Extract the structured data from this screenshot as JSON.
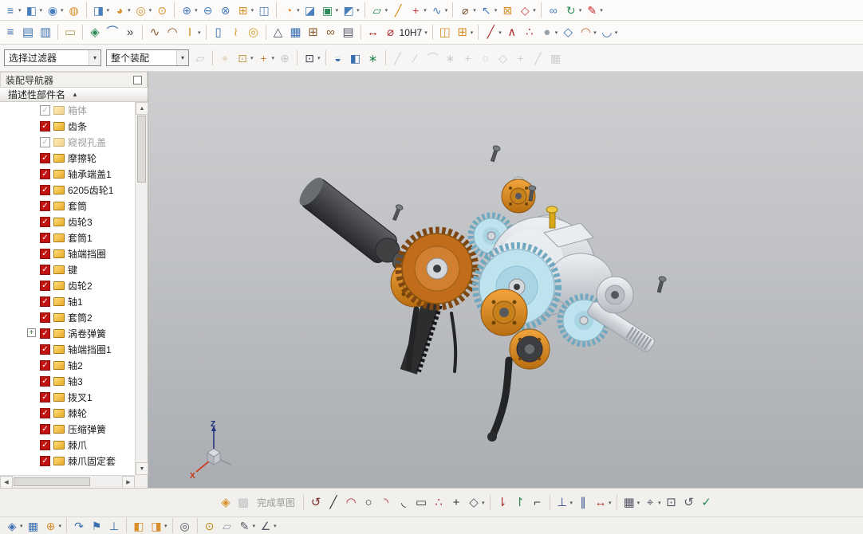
{
  "glyphs": {
    "caret": "▾",
    "check": "✓",
    "plus": "+",
    "sort_asc": "▲",
    "scroll_up": "▲",
    "scroll_down": "▼",
    "scroll_left": "◀",
    "scroll_right": "▶"
  },
  "toolbars": {
    "row1": [
      {
        "name": "sheet-stack-icon",
        "glyph": "≡",
        "color": "#3a6fb0",
        "arrow": true
      },
      {
        "name": "block-feature-icon",
        "glyph": "◧",
        "color": "#4a7fbd",
        "arrow": true
      },
      {
        "name": "cylinder-feature-icon",
        "glyph": "◉",
        "color": "#4a7fbd",
        "arrow": true
      },
      {
        "name": "sphere-feature-icon",
        "glyph": "◍",
        "color": "#d98f2b"
      },
      {
        "sep": true
      },
      {
        "name": "extrude-icon",
        "glyph": "◨",
        "color": "#4a7fbd",
        "arrow": true
      },
      {
        "name": "revolve-icon",
        "glyph": "◕",
        "color": "#d98f2b",
        "arrow": true
      },
      {
        "name": "hole-feature-icon",
        "glyph": "◎",
        "color": "#d98f2b",
        "arrow": true
      },
      {
        "name": "boss-feature-icon",
        "glyph": "⊙",
        "color": "#d98f2b"
      },
      {
        "sep": true
      },
      {
        "name": "boolean-unite-icon",
        "glyph": "⊕",
        "color": "#4a7fbd",
        "arrow": true
      },
      {
        "name": "boolean-subtract-icon",
        "glyph": "⊖",
        "color": "#4a7fbd"
      },
      {
        "name": "boolean-intersect-icon",
        "glyph": "⊗",
        "color": "#4a7fbd"
      },
      {
        "name": "pattern-feature-icon",
        "glyph": "⊞",
        "color": "#d98f2b",
        "arrow": true
      },
      {
        "name": "mirror-feature-icon",
        "glyph": "◫",
        "color": "#4a7fbd"
      },
      {
        "sep": true
      },
      {
        "name": "edge-blend-icon",
        "glyph": "◔",
        "color": "#d98f2b",
        "arrow": true
      },
      {
        "name": "chamfer-icon",
        "glyph": "◪",
        "color": "#4a7fbd"
      },
      {
        "name": "shell-icon",
        "glyph": "▣",
        "color": "#2e8b57",
        "arrow": true
      },
      {
        "name": "trim-body-icon",
        "glyph": "◩",
        "color": "#4a7fbd",
        "arrow": true
      },
      {
        "sep": true
      },
      {
        "name": "datum-plane-icon",
        "glyph": "▱",
        "color": "#2e8b57",
        "arrow": true
      },
      {
        "name": "datum-axis-icon",
        "glyph": "╱",
        "color": "#cc8800"
      },
      {
        "name": "point-feature-icon",
        "glyph": "+",
        "color": "#cc3333",
        "arrow": true
      },
      {
        "name": "swept-icon",
        "glyph": "∿",
        "color": "#4a7fbd",
        "arrow": true
      },
      {
        "sep": true
      },
      {
        "name": "measure-distance-icon",
        "glyph": "⌀",
        "color": "#7a5230",
        "arrow": true
      },
      {
        "name": "move-face-icon",
        "glyph": "↖",
        "color": "#4a7fbd",
        "arrow": true
      },
      {
        "name": "offset-region-icon",
        "glyph": "⊠",
        "color": "#d98f2b"
      },
      {
        "name": "delete-face-icon",
        "glyph": "◇",
        "color": "#cc4444",
        "arrow": true
      },
      {
        "sep": true
      },
      {
        "name": "wave-geometry-icon",
        "glyph": "∞",
        "color": "#4a7fbd"
      },
      {
        "name": "update-model-icon",
        "glyph": "↻",
        "color": "#2e8b57",
        "arrow": true
      },
      {
        "name": "edit-feature-icon",
        "glyph": "✎",
        "color": "#cc2222",
        "arrow": true
      }
    ],
    "row2": [
      {
        "name": "layer-settings-icon",
        "glyph": "≡",
        "color": "#3a6fb0"
      },
      {
        "name": "layer-visible-in-view-icon",
        "glyph": "▤",
        "color": "#3a6fb0"
      },
      {
        "name": "layer-category-icon",
        "glyph": "▥",
        "color": "#3a6fb0"
      },
      {
        "sep": true
      },
      {
        "name": "note-editor-icon",
        "glyph": "▭",
        "color": "#b09a50"
      },
      {
        "sep": true
      },
      {
        "name": "sketch-task-icon",
        "glyph": "◈",
        "color": "#2e8b57"
      },
      {
        "name": "sketch-curve-toolbar-icon",
        "glyph": "⌒",
        "color": "#3a6fb0"
      },
      {
        "name": "toolbar-overflow-icon",
        "glyph": "»",
        "color": "#444"
      },
      {
        "sep": true
      },
      {
        "name": "studio-spline-icon",
        "glyph": "∿",
        "color": "#8a5a2a"
      },
      {
        "name": "face-blend-icon",
        "glyph": "◠",
        "color": "#8a5a2a"
      },
      {
        "name": "text-tool-icon",
        "glyph": "I",
        "color": "#d98f2b",
        "arrow": true
      },
      {
        "sep": true
      },
      {
        "name": "capsule-tool-icon",
        "glyph": "▯",
        "color": "#3a6fb0"
      },
      {
        "name": "spring-tool-icon",
        "glyph": "≀",
        "color": "#d9a02b"
      },
      {
        "name": "ring-tool-icon",
        "glyph": "◎",
        "color": "#d9a02b"
      },
      {
        "sep": true
      },
      {
        "name": "relief-tool-icon",
        "glyph": "△",
        "color": "#556"
      },
      {
        "name": "mesh-grid-icon",
        "glyph": "▦",
        "color": "#3a6fb0"
      },
      {
        "name": "pattern-table-icon",
        "glyph": "⊞",
        "color": "#8a5a2a"
      },
      {
        "name": "gear-pair-icon",
        "glyph": "∞",
        "color": "#8a5a2a"
      },
      {
        "name": "annotation-list-icon",
        "glyph": "▤",
        "color": "#556"
      },
      {
        "sep": true
      },
      {
        "name": "dimension-marker-icon",
        "glyph": "↔",
        "color": "#b03030"
      },
      {
        "name": "tolerance-dropdown",
        "glyph": "⌀",
        "color": "#b03030",
        "label": "10H7",
        "arrow": true
      },
      {
        "sep": true
      },
      {
        "name": "assembly-constraint-icon",
        "glyph": "◫",
        "color": "#d98f2b"
      },
      {
        "name": "add-component-icon",
        "glyph": "⊞",
        "color": "#d98f2b",
        "arrow": true
      },
      {
        "sep": true
      },
      {
        "name": "line-tool-icon",
        "glyph": "╱",
        "color": "#b03030",
        "arrow": true
      },
      {
        "name": "polyline-tool-icon",
        "glyph": "∧",
        "color": "#b03030"
      },
      {
        "name": "node-link-icon",
        "glyph": "∴",
        "color": "#b03030"
      },
      {
        "name": "sphere-display-icon",
        "glyph": "●",
        "color": "#98a2aa",
        "arrow": true
      },
      {
        "name": "isometric-box-icon",
        "glyph": "◇",
        "color": "#3a6fb0"
      },
      {
        "name": "arc-chain-icon",
        "glyph": "◠",
        "color": "#cc6633",
        "arrow": true
      },
      {
        "name": "curve-mesh-icon",
        "glyph": "◡",
        "color": "#3a6fb0",
        "arrow": true
      }
    ],
    "filter_row": {
      "selection_filter_value": "选择过滤器",
      "assembly_scope_value": "整个装配",
      "icons": [
        {
          "name": "fence-filter-icon",
          "glyph": "▱",
          "color": "#9aa0a6",
          "disabled": true
        },
        {
          "sep": true
        },
        {
          "name": "snap-point-icon",
          "glyph": "⌖",
          "color": "#c09a50",
          "disabled": true
        },
        {
          "name": "snap-point-dropdown-icon",
          "glyph": "⊡",
          "color": "#c09a50",
          "arrow": true
        },
        {
          "name": "snap-plus-icon",
          "glyph": "+",
          "color": "#cc8833",
          "arrow": true
        },
        {
          "name": "snap-gray-icon",
          "glyph": "⊕",
          "color": "#9aa0a6",
          "disabled": true
        },
        {
          "sep": true
        },
        {
          "name": "marquee-select-icon",
          "glyph": "⊡",
          "color": "#445",
          "arrow": true
        },
        {
          "sep": true
        },
        {
          "name": "shaded-ball-icon",
          "glyph": "◒",
          "color": "#3a6fb0"
        },
        {
          "name": "cube-display-icon",
          "glyph": "◧",
          "color": "#3a6fb0"
        },
        {
          "name": "burst-icon",
          "glyph": "∗",
          "color": "#2e8b57"
        },
        {
          "sep": true
        },
        {
          "name": "snap-endpoint-icon",
          "glyph": "╱",
          "color": "#a8adb2",
          "disabled": true
        },
        {
          "name": "snap-on-curve-icon",
          "glyph": "∕",
          "color": "#a8adb2",
          "disabled": true
        },
        {
          "name": "snap-tangent-icon",
          "glyph": "⌒",
          "color": "#a8adb2",
          "disabled": true
        },
        {
          "name": "snap-quadrant-icon",
          "glyph": "∗",
          "color": "#a8adb2",
          "disabled": true
        },
        {
          "name": "snap-intersection-icon",
          "glyph": "+",
          "color": "#a8adb2",
          "disabled": true
        },
        {
          "name": "snap-circle-center-icon",
          "glyph": "○",
          "color": "#a8adb2",
          "disabled": true
        },
        {
          "name": "snap-polygon-icon",
          "glyph": "◇",
          "color": "#a8adb2",
          "disabled": true
        },
        {
          "name": "snap-point-on-face-icon",
          "glyph": "+",
          "color": "#a8adb2",
          "disabled": true
        },
        {
          "name": "snap-angled-icon",
          "glyph": "╱",
          "color": "#a8adb2",
          "disabled": true
        },
        {
          "name": "snap-grid-icon",
          "glyph": "▦",
          "color": "#a8adb2",
          "disabled": true
        }
      ]
    }
  },
  "navigator": {
    "title": "装配导航器",
    "column_header": "描述性部件名",
    "items": [
      {
        "label": "箱体",
        "checked": false,
        "dim": true
      },
      {
        "label": "齿条",
        "checked": true
      },
      {
        "label": "窥视孔盖",
        "checked": false,
        "dim": true
      },
      {
        "label": "摩擦轮",
        "checked": true
      },
      {
        "label": "轴承端盖1",
        "checked": true
      },
      {
        "label": "6205齿轮1",
        "checked": true
      },
      {
        "label": "套筒",
        "checked": true
      },
      {
        "label": "齿轮3",
        "checked": true
      },
      {
        "label": "套筒1",
        "checked": true
      },
      {
        "label": "轴端挡圈",
        "checked": true
      },
      {
        "label": "键",
        "checked": true
      },
      {
        "label": "齿轮2",
        "checked": true
      },
      {
        "label": "轴1",
        "checked": true
      },
      {
        "label": "套筒2",
        "checked": true
      },
      {
        "label": "涡卷弹簧",
        "checked": true,
        "expand": true
      },
      {
        "label": "轴端挡圈1",
        "checked": true
      },
      {
        "label": "轴2",
        "checked": true
      },
      {
        "label": "轴3",
        "checked": true
      },
      {
        "label": "拨叉1",
        "checked": true
      },
      {
        "label": "棘轮",
        "checked": true
      },
      {
        "label": "压缩弹簧",
        "checked": true
      },
      {
        "label": "棘爪",
        "checked": true
      },
      {
        "label": "棘爪固定套",
        "checked": true
      }
    ]
  },
  "viewport": {
    "triad": {
      "z": "Z",
      "x": "X"
    }
  },
  "bottom_toolbar": {
    "finish_label": "完成草图",
    "left_icons": [
      {
        "name": "finish-sketch-icon",
        "glyph": "◈",
        "color": "#d98f2b"
      },
      {
        "name": "sketch-checker-icon",
        "glyph": "▩",
        "color": "#9aa0a6",
        "disabled": true
      }
    ],
    "right_icons": [
      {
        "sep": true
      },
      {
        "name": "profile-icon",
        "glyph": "↺",
        "color": "#7a2b2b"
      },
      {
        "name": "line-icon",
        "glyph": "╱",
        "color": "#333"
      },
      {
        "name": "arc-icon",
        "glyph": "◠",
        "color": "#b03030"
      },
      {
        "name": "circle-icon",
        "glyph": "○",
        "color": "#333"
      },
      {
        "name": "fillet-icon",
        "glyph": "◝",
        "color": "#b03030"
      },
      {
        "name": "chamfer-sketch-icon",
        "glyph": "◟",
        "color": "#333"
      },
      {
        "name": "rectangle-icon",
        "glyph": "▭",
        "color": "#333"
      },
      {
        "name": "pattern-curve-icon",
        "glyph": "∴",
        "color": "#b03030"
      },
      {
        "name": "point-icon",
        "glyph": "+",
        "color": "#333"
      },
      {
        "name": "offset-curve-icon",
        "glyph": "◇",
        "color": "#556",
        "arrow": true
      },
      {
        "sep": true
      },
      {
        "name": "quick-trim-icon",
        "glyph": "⇂",
        "color": "#b03030"
      },
      {
        "name": "quick-extend-icon",
        "glyph": "↾",
        "color": "#2e8b57"
      },
      {
        "name": "make-corner-icon",
        "glyph": "⌐",
        "color": "#333"
      },
      {
        "sep": true
      },
      {
        "name": "geometric-constraints-icon",
        "glyph": "⊥",
        "color": "#334a8c",
        "arrow": true
      },
      {
        "name": "parallel-constraint-icon",
        "glyph": "∥",
        "color": "#334a8c"
      },
      {
        "name": "rapid-dimension-icon",
        "glyph": "↔",
        "color": "#b03030",
        "arrow": true
      },
      {
        "sep": true
      },
      {
        "name": "display-constraints-icon",
        "glyph": "▦",
        "color": "#556",
        "arrow": true
      },
      {
        "name": "auto-constrain-icon",
        "glyph": "⌖",
        "color": "#556",
        "arrow": true
      },
      {
        "name": "reference-curve-icon",
        "glyph": "⊡",
        "color": "#556"
      },
      {
        "name": "alternate-solution-icon",
        "glyph": "↺",
        "color": "#556"
      },
      {
        "name": "evaluate-sketch-icon",
        "glyph": "✓",
        "color": "#2e8b57"
      }
    ]
  },
  "status_bar": {
    "icons": [
      {
        "name": "window-cube-icon",
        "glyph": "◈",
        "color": "#3a6fb0",
        "arrow": true
      },
      {
        "name": "view-grid-icon",
        "glyph": "▦",
        "color": "#3a6fb0"
      },
      {
        "name": "add-user-icon",
        "glyph": "⊕",
        "color": "#d98f2b",
        "arrow": true
      },
      {
        "sep": true
      },
      {
        "name": "redo-arrow-icon",
        "glyph": "↷",
        "color": "#3a6fb0"
      },
      {
        "name": "goto-flag-icon",
        "glyph": "⚑",
        "color": "#3a6fb0"
      },
      {
        "name": "anchor-icon",
        "glyph": "⊥",
        "color": "#3a6fb0"
      },
      {
        "sep": true
      },
      {
        "name": "cube-pair-icon",
        "glyph": "◧",
        "color": "#d98f2b"
      },
      {
        "name": "cube-gold-icon",
        "glyph": "◨",
        "color": "#d98f2b",
        "arrow": true
      },
      {
        "sep": true
      },
      {
        "name": "ring-icon",
        "glyph": "◎",
        "color": "#556"
      },
      {
        "sep": true
      },
      {
        "name": "lock-icon",
        "glyph": "⊙",
        "color": "#b8860b"
      },
      {
        "name": "sheet-icon",
        "glyph": "▱",
        "color": "#98a2aa"
      },
      {
        "name": "pencil-icon",
        "glyph": "✎",
        "color": "#556",
        "arrow": true
      },
      {
        "name": "angle-icon",
        "glyph": "∠",
        "color": "#556",
        "arrow": true
      }
    ]
  }
}
